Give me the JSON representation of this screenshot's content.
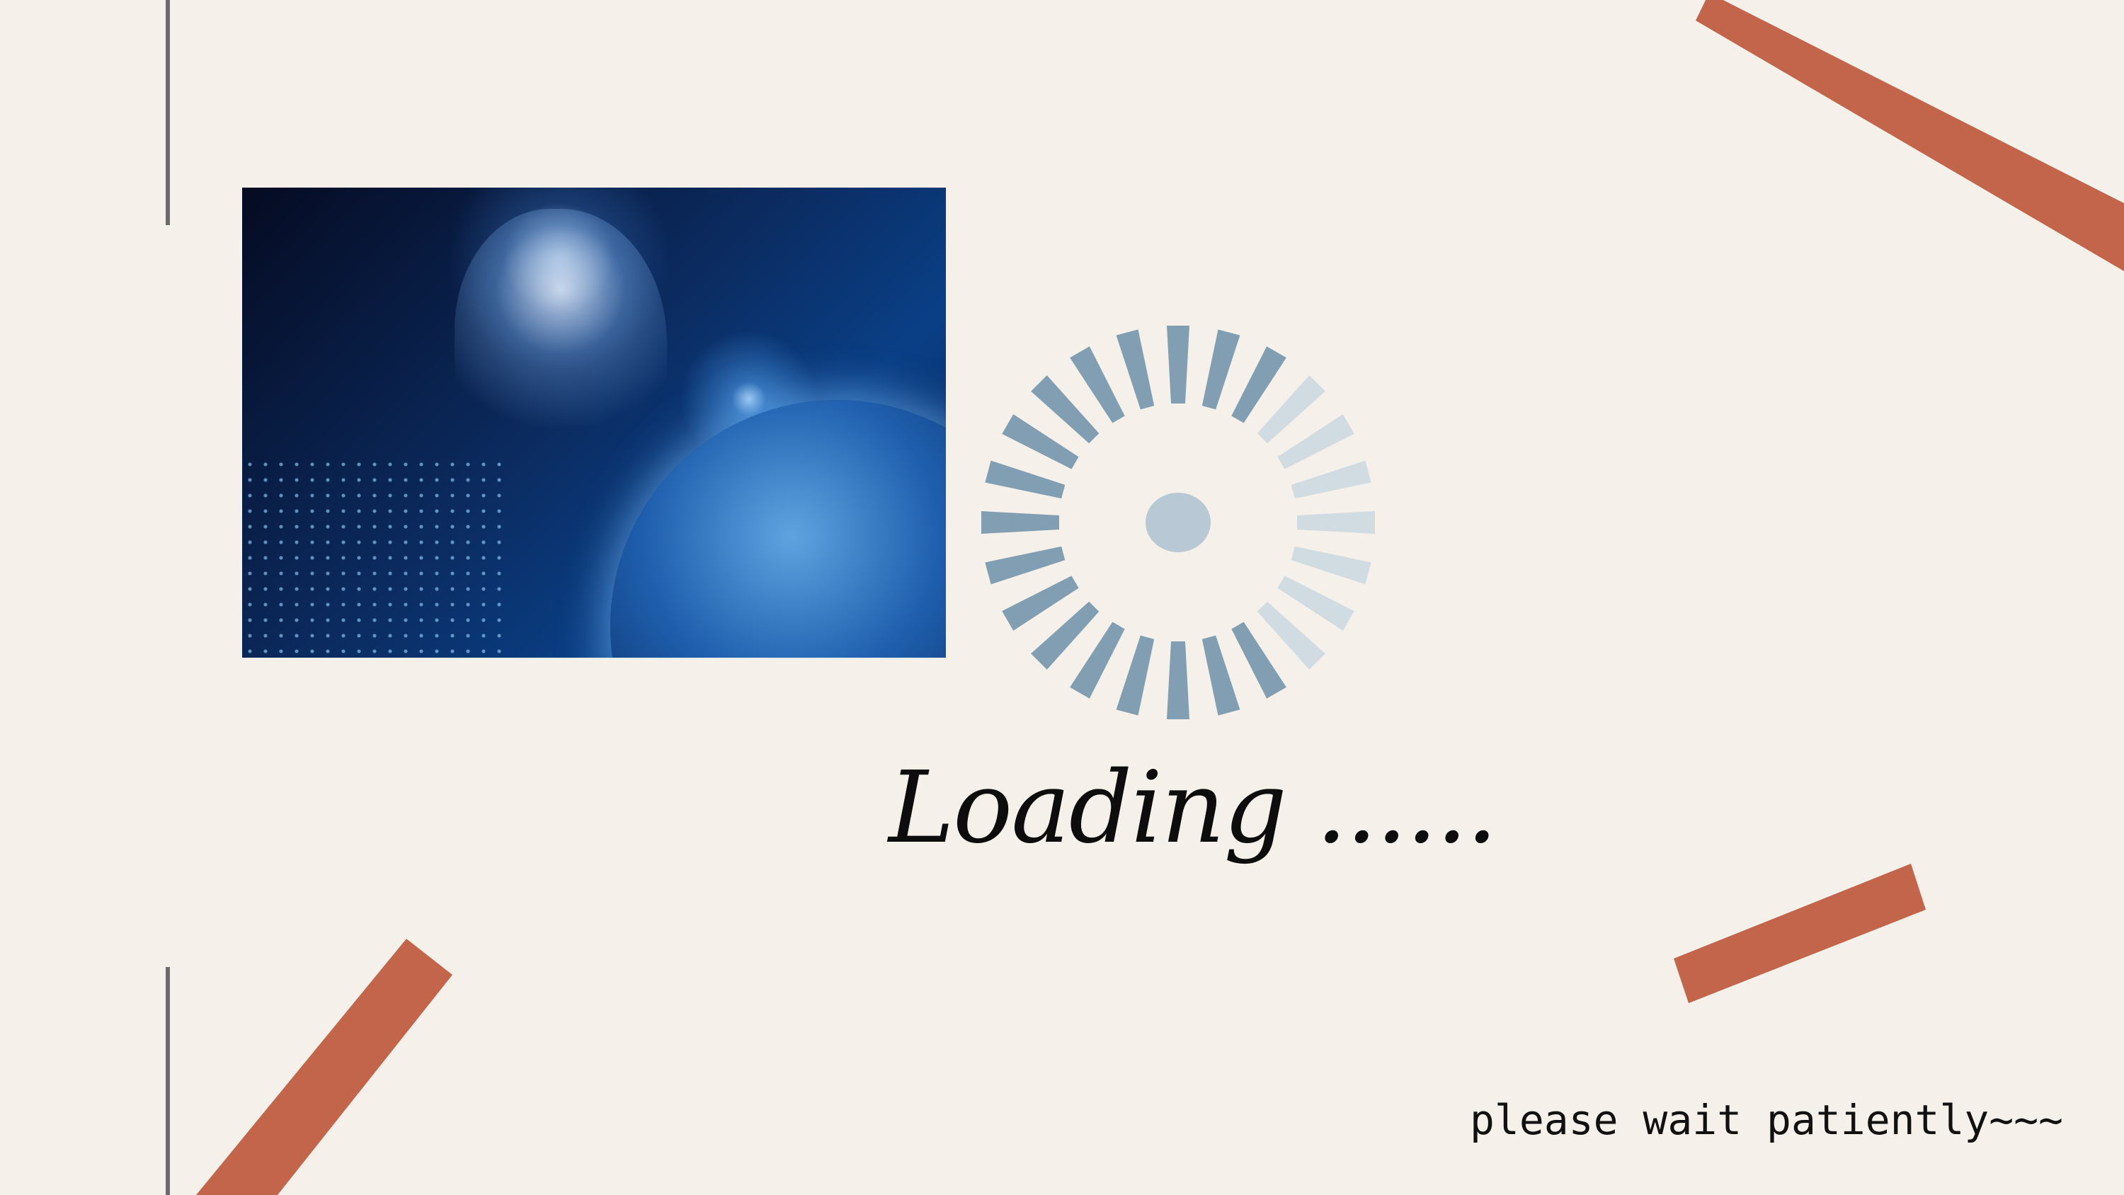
{
  "loading_text": "Loading ......",
  "subtitle": "please wait patiently~~~",
  "spinner": {
    "bar_count": 24,
    "highlight_start_index": 3,
    "highlight_count": 7
  },
  "colors": {
    "background": "#f5f1ea",
    "accent": "#c2654a",
    "spinner_dark": "#819eb3",
    "spinner_light": "#d0dbe2",
    "spinner_center": "#b8c8d4",
    "divider": "#6b6b6b"
  },
  "hero_image": {
    "icon": "ai-head-globe-image"
  }
}
